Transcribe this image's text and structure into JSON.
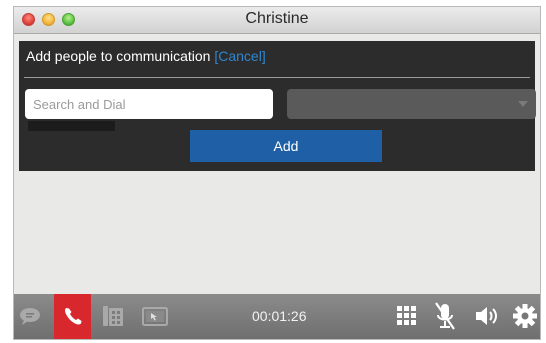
{
  "window": {
    "title": "Christine"
  },
  "panel": {
    "heading": "Add people to communication",
    "cancel_label": "[Cancel]",
    "search_placeholder": "Search and Dial",
    "add_label": "Add"
  },
  "bottombar": {
    "timer": "00:01:26",
    "icons": [
      "chat-icon",
      "hangup-icon",
      "phone-transfer-icon",
      "screen-share-icon",
      "keypad-icon",
      "mute-mic-icon",
      "speaker-icon",
      "settings-icon"
    ]
  },
  "colors": {
    "accent": "#1f5fa6",
    "cancel_link": "#2f86cf",
    "hangup": "#d9272e",
    "panel": "#2c2c2c"
  }
}
